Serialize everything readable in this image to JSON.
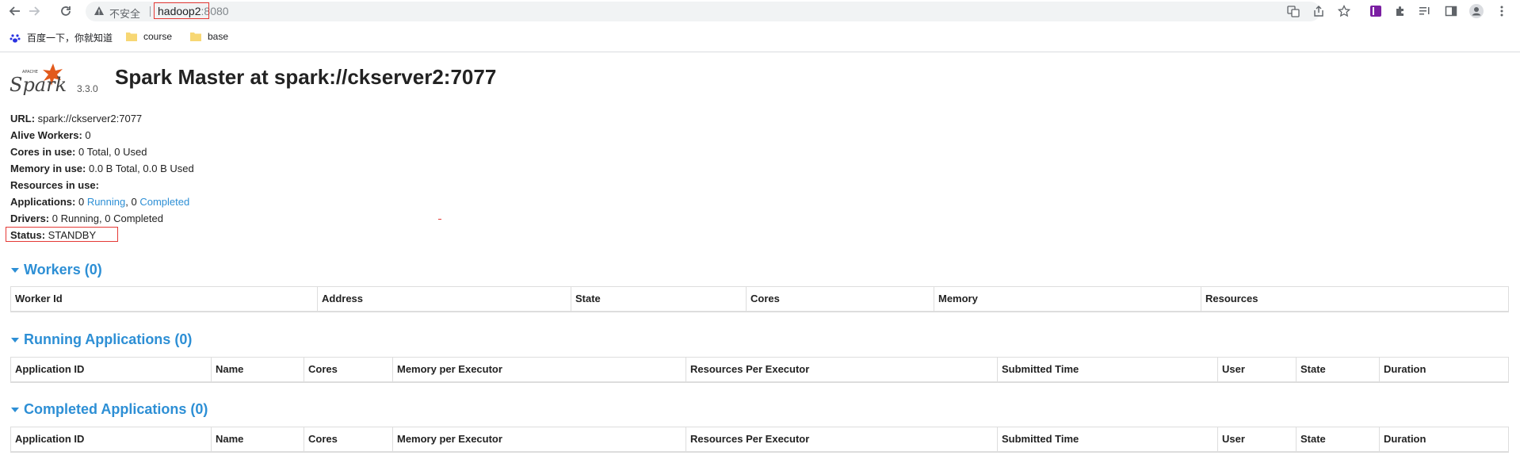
{
  "browser": {
    "insecure_label": "不安全",
    "url_host": "hadoop2",
    "url_port": ":8080",
    "bookmarks": [
      "百度一下，你就知道",
      "course",
      "base"
    ]
  },
  "header": {
    "version": "3.3.0",
    "title": "Spark Master at spark://ckserver2:7077"
  },
  "info": {
    "url_label": "URL:",
    "url_value": " spark://ckserver2:7077",
    "workers_label": "Alive Workers:",
    "workers_value": " 0",
    "cores_label": "Cores in use:",
    "cores_value": " 0 Total, 0 Used",
    "memory_label": "Memory in use:",
    "memory_value": " 0.0 B Total, 0.0 B Used",
    "resources_label": "Resources in use:",
    "apps_label": "Applications:",
    "apps_running_count": " 0 ",
    "apps_running_link": "Running",
    "apps_sep": ", 0 ",
    "apps_completed_link": "Completed",
    "drivers_label": "Drivers:",
    "drivers_value": " 0 Running, 0 Completed",
    "status_label": "Status:",
    "status_value": " STANDBY"
  },
  "workers": {
    "title": "Workers (0)",
    "columns": [
      "Worker Id",
      "Address",
      "State",
      "Cores",
      "Memory",
      "Resources"
    ]
  },
  "running_apps": {
    "title": "Running Applications (0)",
    "columns": [
      "Application ID",
      "Name",
      "Cores",
      "Memory per Executor",
      "Resources Per Executor",
      "Submitted Time",
      "User",
      "State",
      "Duration"
    ]
  },
  "completed_apps": {
    "title": "Completed Applications (0)",
    "columns": [
      "Application ID",
      "Name",
      "Cores",
      "Memory per Executor",
      "Resources Per Executor",
      "Submitted Time",
      "User",
      "State",
      "Duration"
    ]
  },
  "colors": {
    "link": "#2d8fd5",
    "highlight": "#e53935",
    "logo": "#e25a1c"
  }
}
